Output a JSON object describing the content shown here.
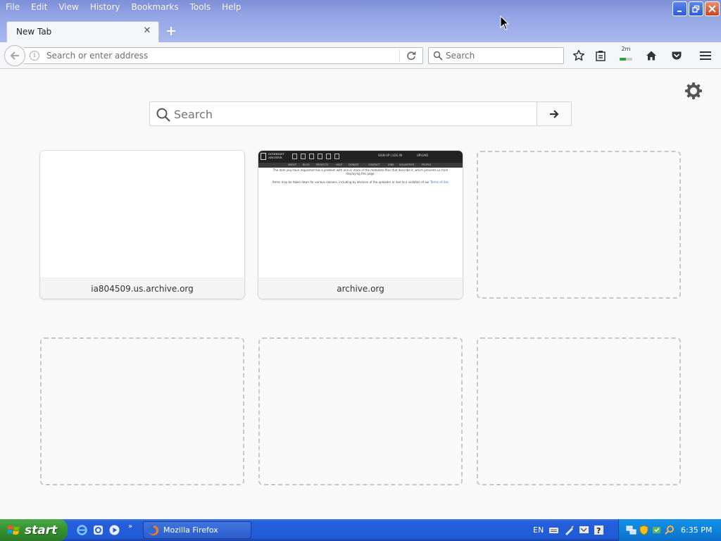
{
  "menubar": {
    "items": [
      "File",
      "Edit",
      "View",
      "History",
      "Bookmarks",
      "Tools",
      "Help"
    ]
  },
  "tab": {
    "title": "New Tab"
  },
  "toolbar": {
    "url_placeholder": "Search or enter address",
    "search_placeholder": "Search",
    "download_badge": "2m"
  },
  "content": {
    "search_placeholder": "Search",
    "tiles": [
      {
        "caption": "ia804509.us.archive.org"
      },
      {
        "caption": "archive.org"
      }
    ],
    "archive_thumb": {
      "logo_text": "INTERNET ARCHIVE",
      "user_text": "SIGN UP | LOG IN",
      "upload_text": "UPLOAD",
      "nav": [
        "ABOUT",
        "BLOG",
        "PROJECTS",
        "HELP",
        "DONATE",
        "CONTACT",
        "JOBS",
        "VOLUNTEER",
        "PEOPLE"
      ],
      "message_1": "The item you have requested has a problem with one or more of the metadata files that describe it, which prevents us from displaying this page.",
      "message_2": "Items may be taken down for various reasons, including by decision of the uploader or due to a violation of our",
      "message_link": "Terms of Use"
    }
  },
  "taskbar": {
    "start_label": "start",
    "firefox_label": "Mozilla Firefox",
    "language": "EN",
    "clock": "6:35 PM"
  },
  "colors": {
    "title_bar": "#95a6e6",
    "taskbar": "#245edc",
    "start_button": "#34902f",
    "systray": "#0f83dc"
  }
}
